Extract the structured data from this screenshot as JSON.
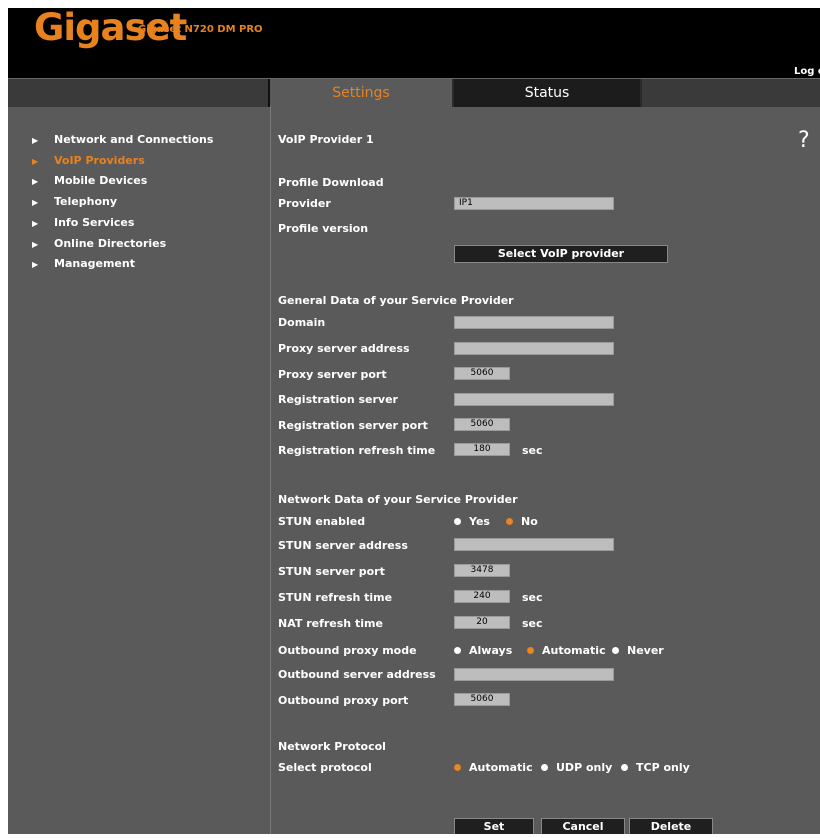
{
  "header": {
    "brand": "Gigaset",
    "model": "Gigaset N720 DM PRO",
    "logout": "Log out"
  },
  "tabs": [
    {
      "label": "Settings",
      "active": true
    },
    {
      "label": "Status",
      "active": false
    }
  ],
  "sidebar": {
    "items": [
      {
        "label": "Network and Connections",
        "active": false
      },
      {
        "label": "VoIP Providers",
        "active": true
      },
      {
        "label": "Mobile Devices",
        "active": false
      },
      {
        "label": "Telephony",
        "active": false
      },
      {
        "label": "Info Services",
        "active": false
      },
      {
        "label": "Online Directories",
        "active": false
      },
      {
        "label": "Management",
        "active": false
      }
    ]
  },
  "main": {
    "title": "VoIP Provider 1",
    "help": "?",
    "profile": {
      "heading": "Profile Download",
      "provider_label": "Provider",
      "provider_value": "IP1",
      "version_label": "Profile version",
      "select_button": "Select VoIP provider"
    },
    "general": {
      "heading": "General Data of your Service Provider",
      "domain_label": "Domain",
      "domain_value": "",
      "proxy_address_label": "Proxy server address",
      "proxy_address_value": "",
      "proxy_port_label": "Proxy server port",
      "proxy_port_value": "5060",
      "reg_server_label": "Registration server",
      "reg_server_value": "",
      "reg_port_label": "Registration server port",
      "reg_port_value": "5060",
      "reg_refresh_label": "Registration refresh time",
      "reg_refresh_value": "180",
      "reg_refresh_unit": "sec"
    },
    "network": {
      "heading": "Network Data of your Service Provider",
      "stun_enabled_label": "STUN enabled",
      "stun_yes": "Yes",
      "stun_no": "No",
      "stun_address_label": "STUN server address",
      "stun_address_value": "",
      "stun_port_label": "STUN server port",
      "stun_port_value": "3478",
      "stun_refresh_label": "STUN refresh time",
      "stun_refresh_value": "240",
      "stun_refresh_unit": "sec",
      "nat_refresh_label": "NAT refresh time",
      "nat_refresh_value": "20",
      "nat_refresh_unit": "sec",
      "outbound_mode_label": "Outbound proxy mode",
      "mode_always": "Always",
      "mode_automatic": "Automatic",
      "mode_never": "Never",
      "outbound_address_label": "Outbound server address",
      "outbound_address_value": "",
      "outbound_port_label": "Outbound proxy port",
      "outbound_port_value": "5060"
    },
    "protocol": {
      "heading": "Network Protocol",
      "select_label": "Select protocol",
      "opt_automatic": "Automatic",
      "opt_udp": "UDP only",
      "opt_tcp": "TCP only"
    },
    "actions": {
      "set": "Set",
      "cancel": "Cancel",
      "delete": "Delete"
    }
  },
  "colors": {
    "accent": "#e8821e",
    "background": "#5a5a5a",
    "header": "#000000"
  }
}
